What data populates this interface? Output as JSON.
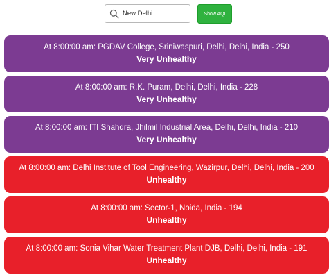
{
  "search": {
    "value": "New Delhi",
    "icon": "search-icon"
  },
  "show_button": {
    "label": "Show AQI",
    "color": "#2fb23f"
  },
  "colors": {
    "very_unhealthy": "#7c3b92",
    "unhealthy": "#e8202a"
  },
  "cards": [
    {
      "station": "At 8:00:00 am: PGDAV College, Sriniwaspuri, Delhi, Delhi, India - 250",
      "category": "Very Unhealthy",
      "level": "very_unhealthy"
    },
    {
      "station": "At 8:00:00 am: R.K. Puram, Delhi, Delhi, India - 228",
      "category": "Very Unhealthy",
      "level": "very_unhealthy"
    },
    {
      "station": "At 8:00:00 am: ITI Shahdra, Jhilmil Industrial Area, Delhi, Delhi, India - 210",
      "category": "Very Unhealthy",
      "level": "very_unhealthy"
    },
    {
      "station": "At 8:00:00 am: Delhi Institute of Tool Engineering, Wazirpur, Delhi, Delhi, India - 200",
      "category": "Unhealthy",
      "level": "unhealthy"
    },
    {
      "station": "At 8:00:00 am: Sector-1, Noida, India - 194",
      "category": "Unhealthy",
      "level": "unhealthy"
    },
    {
      "station": "At 8:00:00 am: Sonia Vihar Water Treatment Plant DJB, Delhi, Delhi, India - 191",
      "category": "Unhealthy",
      "level": "unhealthy"
    }
  ]
}
